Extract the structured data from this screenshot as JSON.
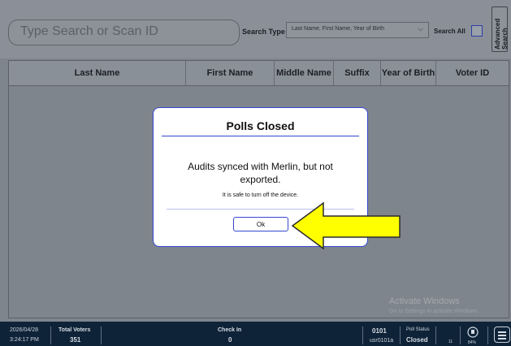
{
  "search": {
    "placeholder": "Type Search or Scan ID",
    "search_type_label": "Search Type",
    "search_type_value": "Last Name, First Name, Year of Birth",
    "search_all_label": "Search All",
    "advanced_label": "Advanced\nSearch"
  },
  "table": {
    "columns": [
      "Last Name",
      "First Name",
      "Middle Name",
      "Suffix",
      "Year of Birth",
      "Voter ID"
    ]
  },
  "modal": {
    "title": "Polls Closed",
    "message": "Audits synced with Merlin, but not exported.",
    "submessage": "It is safe to turn off the device.",
    "ok_label": "Ok"
  },
  "watermark": {
    "title": "Activate Windows",
    "subtitle": "Go to Settings to activate Windows."
  },
  "status_bar": {
    "date": "2026/04/28",
    "time": "3:24:17 PM",
    "total_voters_label": "Total Voters",
    "total_voters_value": "351",
    "check_in_label": "Check In",
    "check_in_value": "0",
    "precinct": "0101",
    "user": "usr0101a",
    "poll_status_label": "Poll Status",
    "poll_status_value": "Closed",
    "count_value": "11",
    "battery_value": "84%"
  },
  "colors": {
    "accent": "#3548d0",
    "status_bar_bg": "#0f2338",
    "callout_arrow": "#ffff00"
  },
  "icons": {
    "select_chevron": "chevron-down-icon",
    "battery": "battery-icon",
    "menu": "hamburger-menu-icon",
    "callout": "arrow-left-callout-icon"
  }
}
